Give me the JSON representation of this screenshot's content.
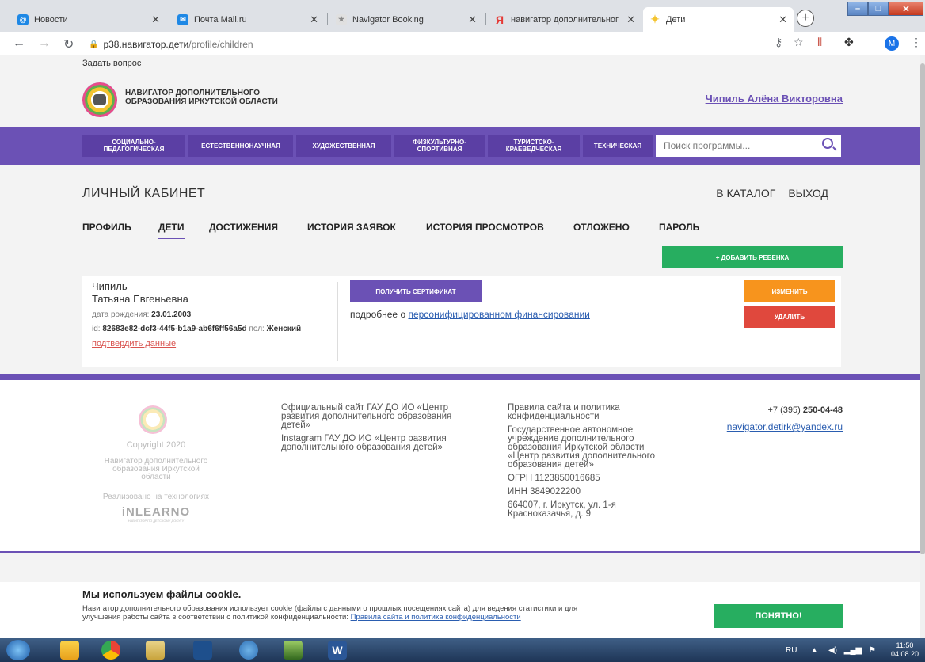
{
  "browser": {
    "tabs": [
      {
        "title": "Новости",
        "icon": "mail-ru-icon",
        "color": "#1e88e5"
      },
      {
        "title": "Почта Mail.ru",
        "icon": "mail-icon",
        "color": "#1e88e5"
      },
      {
        "title": "Navigator Booking",
        "icon": "navigator-icon",
        "color": "#bbbbbb"
      },
      {
        "title": "навигатор дополнительног",
        "icon": "yandex-icon",
        "color": "#e53935"
      },
      {
        "title": "Дети",
        "icon": "puzzle-icon",
        "color": "#f4c430"
      }
    ],
    "url_host": "p38.навигатор.дети",
    "url_path": "/profile/children",
    "profile_initial": "M"
  },
  "header": {
    "ask_question": "Задать вопрос",
    "site_title_line1": "НАВИГАТОР ДОПОЛНИТЕЛЬНОГО",
    "site_title_line2": "ОБРАЗОВАНИЯ ИРКУТСКОЙ ОБЛАСТИ",
    "user_name": "Чипиль Алёна Викторовна"
  },
  "categories": [
    {
      "line1": "СОЦИАЛЬНО-",
      "line2": "ПЕДАГОГИЧЕСКАЯ"
    },
    {
      "line1": "ЕСТЕСТВЕННОНАУЧНАЯ",
      "line2": ""
    },
    {
      "line1": "ХУДОЖЕСТВЕННАЯ",
      "line2": ""
    },
    {
      "line1": "ФИЗКУЛЬТУРНО-",
      "line2": "СПОРТИВНАЯ"
    },
    {
      "line1": "ТУРИСТСКО-",
      "line2": "КРАЕВЕДЧЕСКАЯ"
    },
    {
      "line1": "ТЕХНИЧЕСКАЯ",
      "line2": ""
    }
  ],
  "search": {
    "placeholder": "Поиск программы..."
  },
  "cabinet": {
    "title": "ЛИЧНЫЙ КАБИНЕТ",
    "catalog_link": "В КАТАЛОГ",
    "logout_link": "ВЫХОД",
    "tabs": [
      "ПРОФИЛЬ",
      "ДЕТИ",
      "ДОСТИЖЕНИЯ",
      "ИСТОРИЯ ЗАЯВОК",
      "ИСТОРИЯ ПРОСМОТРОВ",
      "ОТЛОЖЕНО",
      "ПАРОЛЬ"
    ],
    "active_tab": "ДЕТИ",
    "add_child": "+ ДОБАВИТЬ РЕБЕНКА"
  },
  "child": {
    "surname": "Чипиль",
    "name": "Татьяна Евгеньевна",
    "birth_label": "дата рождения: ",
    "birth_date": "23.01.2003",
    "id_label": "id: ",
    "id_value": "82683e82-dcf3-44f5-b1a9-ab6f6ff56a5d",
    "sex_label": " пол: ",
    "sex_value": "Женский",
    "confirm_link": "подтвердить данные",
    "cert_button": "ПОЛУЧИТЬ СЕРТИФИКАТ",
    "more_prefix": "подробнее о ",
    "more_link": "персонифицированном финансировании",
    "edit_button": "ИЗМЕНИТЬ",
    "delete_button": "УДАЛИТЬ"
  },
  "footer": {
    "copyright": "Copyright 2020",
    "navigator_line1": "Навигатор дополнительного",
    "navigator_line2": "образования Иркутской",
    "navigator_line3": "области",
    "tech": "Реализовано на технологиях",
    "inlearno": "iNLEARNO",
    "inlearno_sub": "НАВИГАТОР ПО ДЕТСКОМУ ДОСУГУ",
    "official_line1": "Официальный сайт ГАУ ДО ИО «Центр",
    "official_line2": "развития дополнительного образования",
    "official_line3": "детей»",
    "instagram_line1": "Instagram ГАУ ДО ИО «Центр развития",
    "instagram_line2": "дополнительного образования детей»",
    "rules_line1": "Правила сайта и политика",
    "rules_line2": "конфиденциальности",
    "org_line1": "Государственное автономное",
    "org_line2": "учреждение дополнительного",
    "org_line3": "образования Иркутской области",
    "org_line4": "«Центр развития дополнительного",
    "org_line5": "образования детей»",
    "ogrn": "ОГРН 1123850016685",
    "inn": "ИНН 3849022200",
    "addr_line1": "664007, г. Иркутск, ул. 1-я",
    "addr_line2": "Красноказачья, д. 9",
    "phone_prefix": "+7 (395) ",
    "phone_number": "250-04-48",
    "email": "navigator.detirk@yandex.ru"
  },
  "cookie": {
    "title": "Мы используем файлы cookie.",
    "text_line1": "Навигатор дополнительного образования использует cookie (файлы с данными о прошлых посещениях сайта) для ведения статистики и для",
    "text_line2": "улучшения работы сайта в соответствии с политикой конфиденциальности: ",
    "link": "Правила сайта и политика конфиденциальности",
    "button": "ПОНЯТНО!"
  },
  "taskbar": {
    "lang": "RU",
    "time": "11:50",
    "date": "04.08.20"
  }
}
